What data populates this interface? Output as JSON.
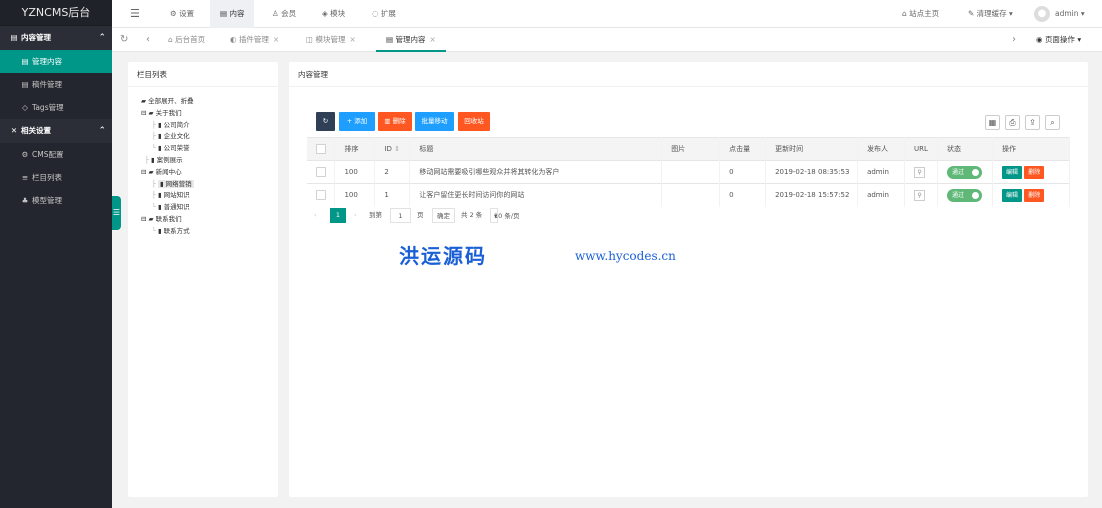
{
  "app_title": "YZNCMS后台",
  "sidebar": {
    "groups": [
      {
        "label": "内容管理"
      },
      {
        "label": "相关设置"
      }
    ],
    "items": [
      {
        "label": "管理内容"
      },
      {
        "label": "稿件管理"
      },
      {
        "label": "Tags管理"
      },
      {
        "label": "CMS配置"
      },
      {
        "label": "栏目列表"
      },
      {
        "label": "模型管理"
      }
    ]
  },
  "topnav": {
    "items": [
      {
        "label": "设置"
      },
      {
        "label": "内容"
      },
      {
        "label": "会员"
      },
      {
        "label": "模块"
      },
      {
        "label": "扩展"
      }
    ],
    "home": "站点主页",
    "cache": "清理缓存",
    "user": "admin"
  },
  "tabs": {
    "items": [
      {
        "label": "后台首页"
      },
      {
        "label": "插件管理"
      },
      {
        "label": "模块管理"
      },
      {
        "label": "管理内容"
      }
    ],
    "page_ops": "页面操作"
  },
  "category_panel": {
    "title": "栏目列表",
    "expand": "全部展开、折叠",
    "tree": [
      "关于我们",
      "公司简介",
      "企业文化",
      "公司荣誉",
      "案例展示",
      "新闻中心",
      "网络营销",
      "网站知识",
      "普通知识",
      "联系我们",
      "联系方式"
    ]
  },
  "content_panel": {
    "title": "内容管理",
    "toolbar": {
      "add": "添加",
      "delete": "删除",
      "move": "批量移动",
      "recycle": "回收站"
    },
    "columns": [
      "排序",
      "ID",
      "标题",
      "图片",
      "点击量",
      "更新时间",
      "发布人",
      "URL",
      "状态",
      "操作"
    ],
    "rows": [
      {
        "sort": "100",
        "id": "2",
        "title": "移动网站需要吸引哪些观众并将其转化为客户",
        "image": "",
        "hits": "0",
        "updated": "2019-02-18 08:35:53",
        "author": "admin",
        "status": "通过",
        "edit": "编辑",
        "del": "删除"
      },
      {
        "sort": "100",
        "id": "1",
        "title": "让客户留住更长时间访问你的网站",
        "image": "",
        "hits": "0",
        "updated": "2019-02-18 15:57:52",
        "author": "admin",
        "status": "通过",
        "edit": "编辑",
        "del": "删除"
      }
    ],
    "pagination": {
      "current": "1",
      "goto": "到第",
      "page_value": "1",
      "page": "页",
      "confirm": "确定",
      "total": "共 2 条",
      "per_page": "10 条/页"
    }
  },
  "watermark": {
    "cn": "洪运源码",
    "url": "www.hycodes.cn"
  },
  "colors": {
    "sidebar": "#23262e",
    "accent": "#009688",
    "blue": "#1e9fff",
    "orange": "#ff5722",
    "green": "#5fb878"
  }
}
